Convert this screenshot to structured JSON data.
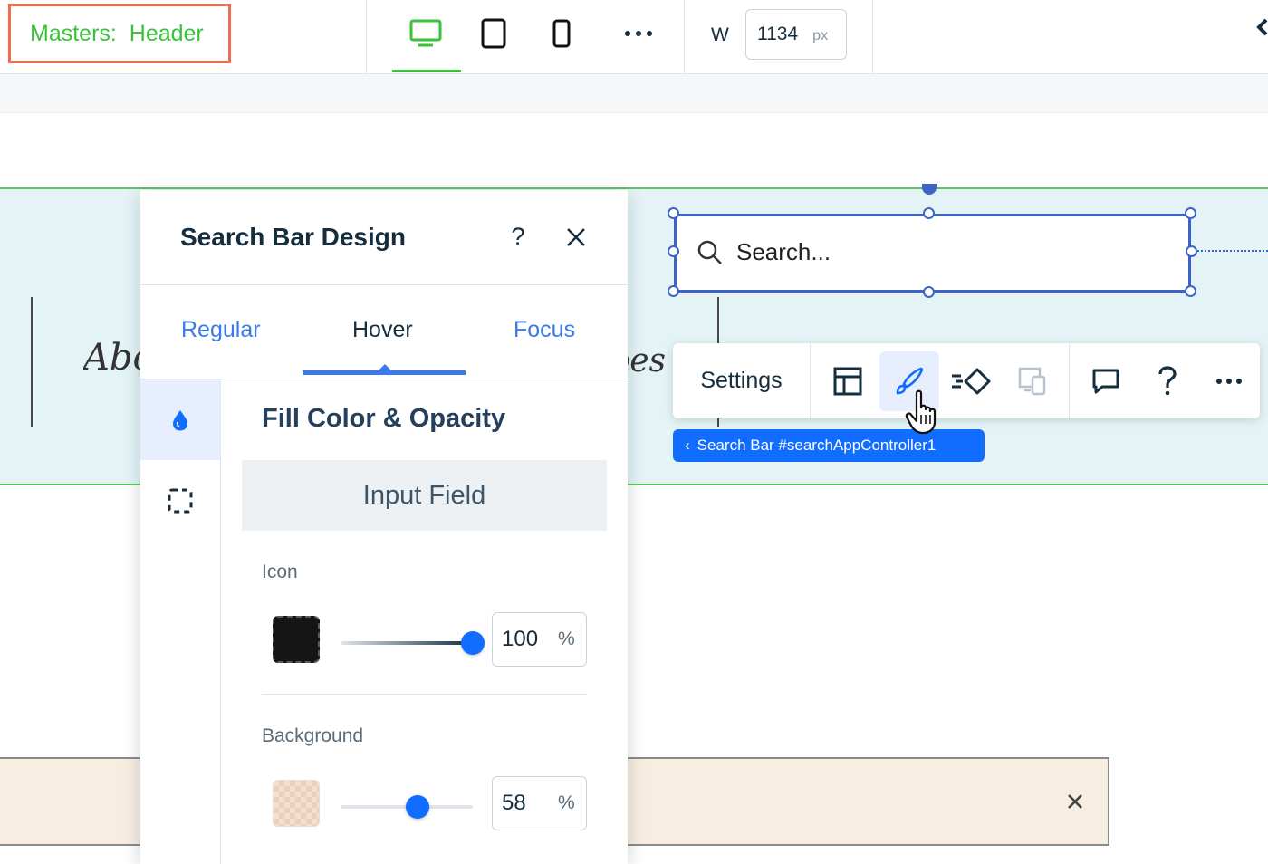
{
  "topbar": {
    "masters_prefix": "Masters:",
    "masters_page": "Header",
    "devices": [
      "desktop-icon",
      "tablet-icon",
      "mobile-icon"
    ],
    "more_label": "more-icon",
    "width_label": "W",
    "width_value": "1134",
    "width_unit": "px"
  },
  "canvas": {
    "search_placeholder": "Search...",
    "bg_text_left": "Abo",
    "bg_text_right": "pes"
  },
  "toolbar": {
    "settings_label": "Settings",
    "buttons": [
      "layout-icon",
      "design-brush-icon",
      "animation-icon",
      "responsive-icon",
      "comment-icon",
      "help-icon",
      "more-icon"
    ],
    "breadcrumb": "Search Bar #searchAppController1",
    "breadcrumb_chevron": "‹"
  },
  "panel": {
    "title": "Search Bar Design",
    "help_glyph": "?",
    "tabs": [
      {
        "label": "Regular",
        "active": false
      },
      {
        "label": "Hover",
        "active": true
      },
      {
        "label": "Focus",
        "active": false
      }
    ],
    "section_title": "Fill Color & Opacity",
    "part_selector": "Input Field",
    "icon": {
      "label": "Icon",
      "color": "#151515",
      "opacity_value": "100",
      "opacity_fraction": 1.0,
      "unit": "%"
    },
    "background": {
      "label": "Background",
      "color": "#f2ddc9",
      "opacity_value": "58",
      "opacity_fraction": 0.58,
      "unit": "%"
    }
  },
  "colors": {
    "accent": "#116dff",
    "masters_green": "#3ac23a",
    "highlight_box": "#ee6d52",
    "selection_blue": "#3c64c8"
  }
}
